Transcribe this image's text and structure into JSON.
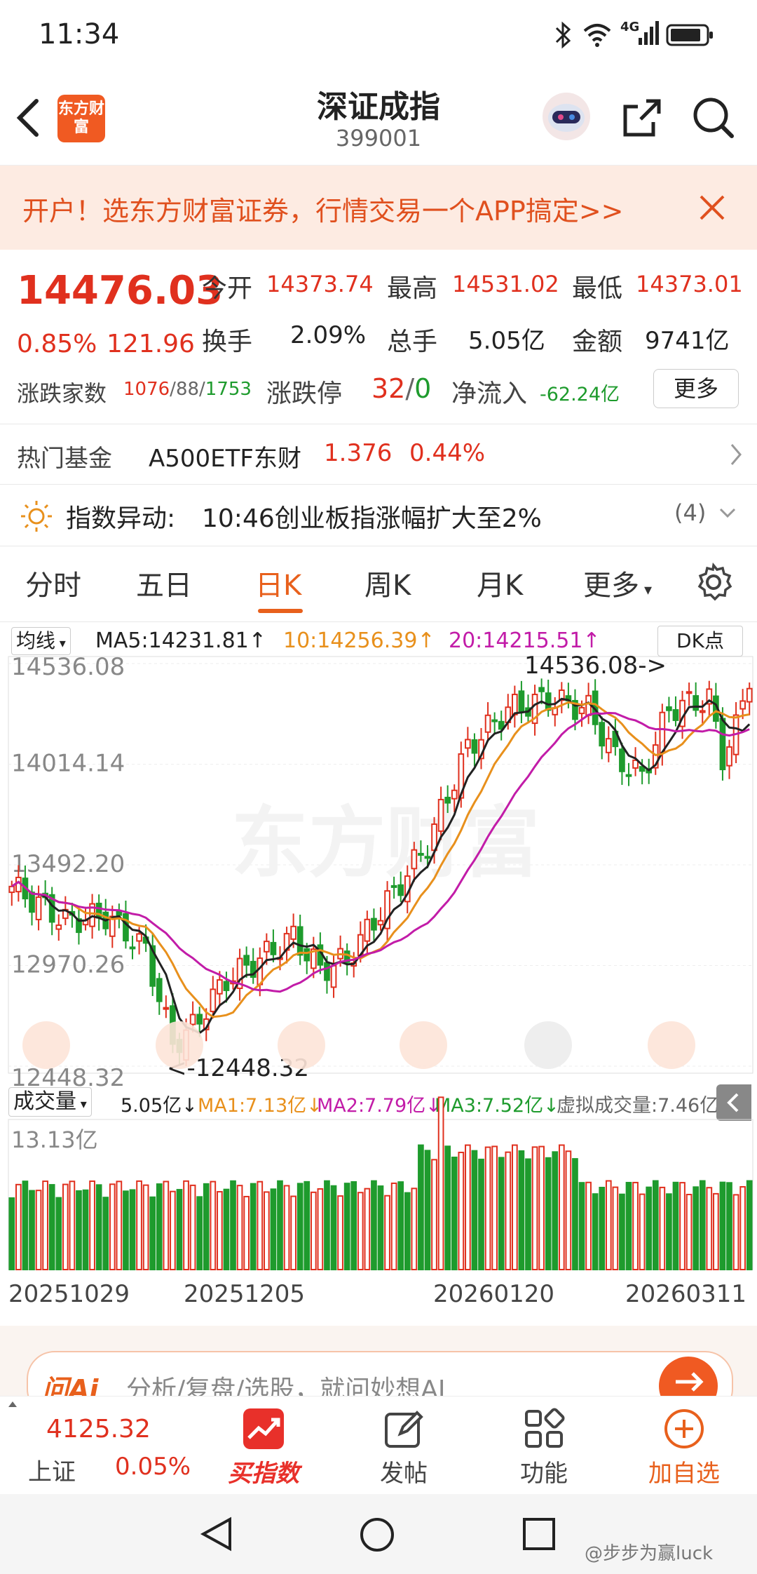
{
  "status": {
    "time": "11:34",
    "network": "4G"
  },
  "header": {
    "title": "深证成指",
    "code": "399001",
    "logo_text": "东方财富"
  },
  "banner": {
    "text": "开户！选东方财富证券，行情交易一个APP搞定>>"
  },
  "quote": {
    "price": "14476.03",
    "change_pct": "0.85%",
    "change": "121.96",
    "open_label": "今开",
    "open": "14373.74",
    "high_label": "最高",
    "high": "14531.02",
    "low_label": "最低",
    "low": "14373.01",
    "turnover_label": "换手",
    "turnover": "2.09%",
    "volume_label": "总手",
    "volume": "5.05亿",
    "amount_label": "金额",
    "amount": "9741亿",
    "breadth_label": "涨跌家数",
    "breadth_up": "1076",
    "breadth_flat": "88",
    "breadth_down": "1753",
    "limit_label": "涨跌停",
    "limit_up": "32",
    "limit_down": "0",
    "netflow_label": "净流入",
    "netflow": "-62.24亿",
    "more_button": "更多"
  },
  "hot_fund": {
    "label": "热门基金",
    "name": "A500ETF东财",
    "price": "1.376",
    "pct": "0.44%"
  },
  "alert": {
    "label": "指数异动:",
    "text": "10:46创业板指涨幅扩大至2%",
    "count": "(4)"
  },
  "tabs": [
    "分时",
    "五日",
    "日K",
    "周K",
    "月K",
    "更多"
  ],
  "active_tab": 2,
  "ma_bar": {
    "selector": "均线",
    "ma5": "MA5:14231.81↑",
    "ma10": "10:14256.39↑",
    "ma20": "20:14215.51↑",
    "dk": "DK点"
  },
  "kchart": {
    "yticks": [
      "14536.08",
      "14014.14",
      "13492.20",
      "12970.26",
      "12448.32"
    ],
    "high_note": "14536.08->",
    "low_note": "<-12448.32",
    "watermark": "东方财富",
    "colors": {
      "up": "#e0301e",
      "down": "#1e9b2d",
      "ma5": "#222222",
      "ma10": "#e8901c",
      "ma20": "#c21ca8"
    }
  },
  "vol_bar": {
    "selector": "成交量",
    "vol": "5.05亿↓",
    "ma1": "MA1:7.13亿↓",
    "ma2": "MA2:7.79亿↓",
    "ma3": "MA3:7.52亿↓",
    "virtual": "虚拟成交量:7.46亿"
  },
  "volchart": {
    "top_label": "13.13亿",
    "dates": [
      "20251029",
      "20251205",
      "20260120",
      "20260311"
    ]
  },
  "ask_ai": {
    "brand": "问Ai",
    "text": "分析/复盘/选股，就问妙想AI"
  },
  "bottom_nav": {
    "index_price": "4125.32",
    "index_name": "上证",
    "index_pct": "0.05%",
    "items": [
      "买指数",
      "发帖",
      "功能",
      "加自选"
    ]
  },
  "watermark_footer": "@步步为赢luck"
}
